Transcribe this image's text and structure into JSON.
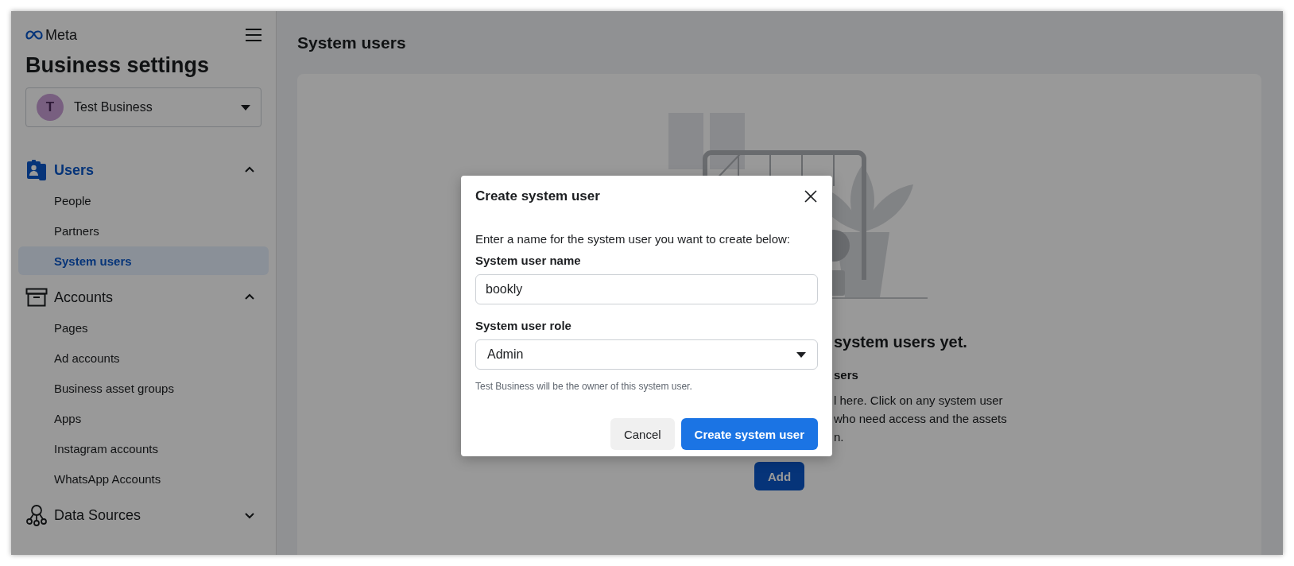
{
  "sidebar": {
    "brand": "Meta",
    "title": "Business settings",
    "business": {
      "initial": "T",
      "name": "Test Business"
    },
    "sections": [
      {
        "label": "Users",
        "kind": "users",
        "expanded": true,
        "selected": true,
        "children": [
          {
            "label": "People",
            "selected": false
          },
          {
            "label": "Partners",
            "selected": false
          },
          {
            "label": "System users",
            "selected": true
          }
        ]
      },
      {
        "label": "Accounts",
        "kind": "accounts",
        "expanded": true,
        "selected": false,
        "children": [
          {
            "label": "Pages",
            "selected": false
          },
          {
            "label": "Ad accounts",
            "selected": false
          },
          {
            "label": "Business asset groups",
            "selected": false
          },
          {
            "label": "Apps",
            "selected": false
          },
          {
            "label": "Instagram accounts",
            "selected": false
          },
          {
            "label": "WhatsApp Accounts",
            "selected": false
          }
        ]
      },
      {
        "label": "Data Sources",
        "kind": "data",
        "expanded": false,
        "selected": false
      }
    ]
  },
  "main": {
    "title": "System users",
    "empty_state": {
      "heading": "system users yet.",
      "subheading": "sers",
      "lines": [
        "l here. Click on any system user",
        "who need access and the assets",
        "n."
      ],
      "button": "Add"
    }
  },
  "dialog": {
    "title": "Create system user",
    "intro": "Enter a name for the system user you want to create below:",
    "fields": [
      {
        "kind": "text",
        "label": "System user name",
        "value": "bookly"
      },
      {
        "kind": "select",
        "label": "System user role",
        "value": "Admin"
      }
    ],
    "hint": "Test Business will be the owner of this system user.",
    "buttons": [
      {
        "label": "Cancel",
        "primary": false
      },
      {
        "label": "Create system user",
        "primary": true
      }
    ]
  }
}
